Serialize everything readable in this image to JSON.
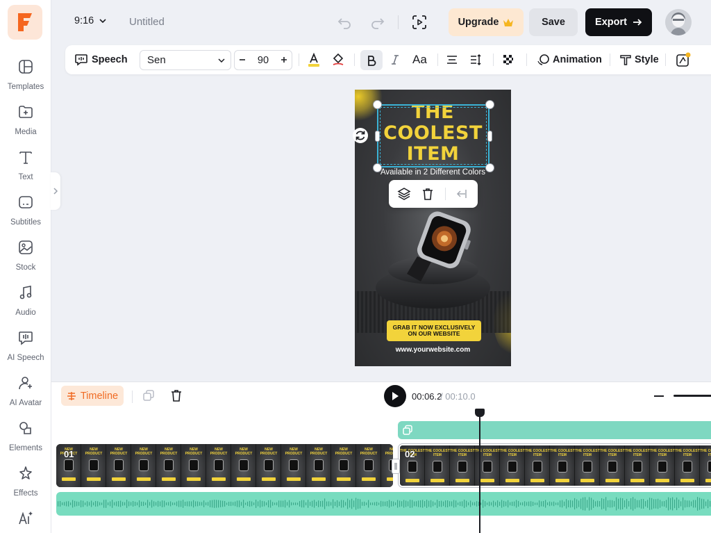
{
  "header": {
    "aspect_ratio": "9:16",
    "document_title": "Untitled",
    "upgrade_label": "Upgrade",
    "save_label": "Save",
    "export_label": "Export"
  },
  "sidebar": {
    "items": [
      {
        "label": "Templates",
        "icon": "templates-icon"
      },
      {
        "label": "Media",
        "icon": "media-icon"
      },
      {
        "label": "Text",
        "icon": "text-icon"
      },
      {
        "label": "Subtitles",
        "icon": "subtitles-icon"
      },
      {
        "label": "Stock",
        "icon": "stock-icon"
      },
      {
        "label": "Audio",
        "icon": "audio-icon"
      },
      {
        "label": "AI Speech",
        "icon": "ai-speech-icon"
      },
      {
        "label": "AI Avatar",
        "icon": "ai-avatar-icon"
      },
      {
        "label": "Elements",
        "icon": "elements-icon"
      },
      {
        "label": "Effects",
        "icon": "effects-icon"
      },
      {
        "label": "AI Tools",
        "icon": "ai-tools-icon"
      }
    ]
  },
  "toolbar": {
    "speech_label": "Speech",
    "font_family": "Sen",
    "font_size": "90",
    "animation_label": "Animation",
    "style_label": "Style",
    "case_label": "Aa",
    "text_color": "#f2d33b",
    "highlight_color": "#e23b3b"
  },
  "canvas": {
    "title_lines": [
      "THE",
      "COOLEST",
      "ITEM"
    ],
    "subtitle": "Available in 2 Different Colors",
    "cta_text": "GRAB IT NOW EXCLUSIVELY ON OUR WEBSITE",
    "website": "www.yourwebsite.com",
    "accent_color": "#f2d33b"
  },
  "timeline": {
    "tab_label": "Timeline",
    "current_time": "00:06.2",
    "total_time": "/ 00:10.0",
    "clips": [
      {
        "number": "01",
        "thumb_text": "NEW PRODUCT"
      },
      {
        "number": "02",
        "thumb_text": "THE COOLEST ITEM"
      }
    ],
    "audio_color": "#78dcbf",
    "overlay_color": "#7ed8c1"
  }
}
